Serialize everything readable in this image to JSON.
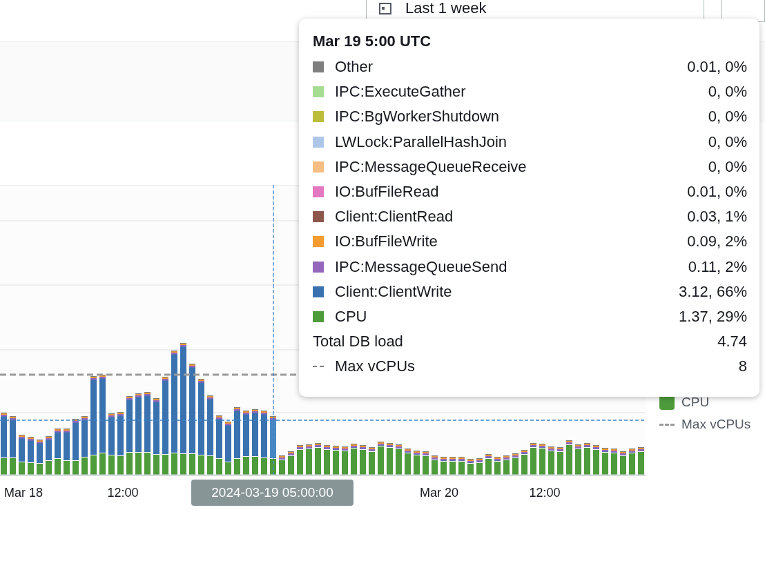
{
  "toolbar": {
    "time_range": "Last 1 week"
  },
  "chart": {
    "x_labels": [
      "Mar 18",
      "12:00",
      "Mar 20",
      "12:00"
    ],
    "hover_label": "2024-03-19 05:00:00"
  },
  "legend": [
    {
      "label": "CPU",
      "kind": "swatch",
      "color": "#4e9b3c"
    },
    {
      "label": "Max vCPUs",
      "kind": "dashed"
    }
  ],
  "tooltip": {
    "title": "Mar 19 5:00 UTC",
    "rows": [
      {
        "label": "Other",
        "value": "0.01, 0%",
        "kind": "swatch",
        "color": "#7f7f7f"
      },
      {
        "label": "IPC:ExecuteGather",
        "value": "0, 0%",
        "kind": "swatch",
        "color": "#a6dc92"
      },
      {
        "label": "IPC:BgWorkerShutdown",
        "value": "0, 0%",
        "kind": "swatch",
        "color": "#bcbd3a"
      },
      {
        "label": "LWLock:ParallelHashJoin",
        "value": "0, 0%",
        "kind": "swatch",
        "color": "#aec7e8"
      },
      {
        "label": "IPC:MessageQueueReceive",
        "value": "0, 0%",
        "kind": "swatch",
        "color": "#f7be84"
      },
      {
        "label": "IO:BufFileRead",
        "value": "0.01, 0%",
        "kind": "swatch",
        "color": "#e377c2"
      },
      {
        "label": "Client:ClientRead",
        "value": "0.03, 1%",
        "kind": "swatch",
        "color": "#8c564b"
      },
      {
        "label": "IO:BufFileWrite",
        "value": "0.09, 2%",
        "kind": "swatch",
        "color": "#f49c2f"
      },
      {
        "label": "IPC:MessageQueueSend",
        "value": "0.11, 2%",
        "kind": "swatch",
        "color": "#9467bd"
      },
      {
        "label": "Client:ClientWrite",
        "value": "3.12, 66%",
        "kind": "swatch",
        "color": "#3a72b0"
      },
      {
        "label": "CPU",
        "value": "1.37, 29%",
        "kind": "swatch",
        "color": "#4e9b3c"
      },
      {
        "label": "Total DB load",
        "value": "4.74",
        "kind": "total"
      },
      {
        "label": "Max vCPUs",
        "value": "8",
        "kind": "dashed"
      }
    ]
  }
}
